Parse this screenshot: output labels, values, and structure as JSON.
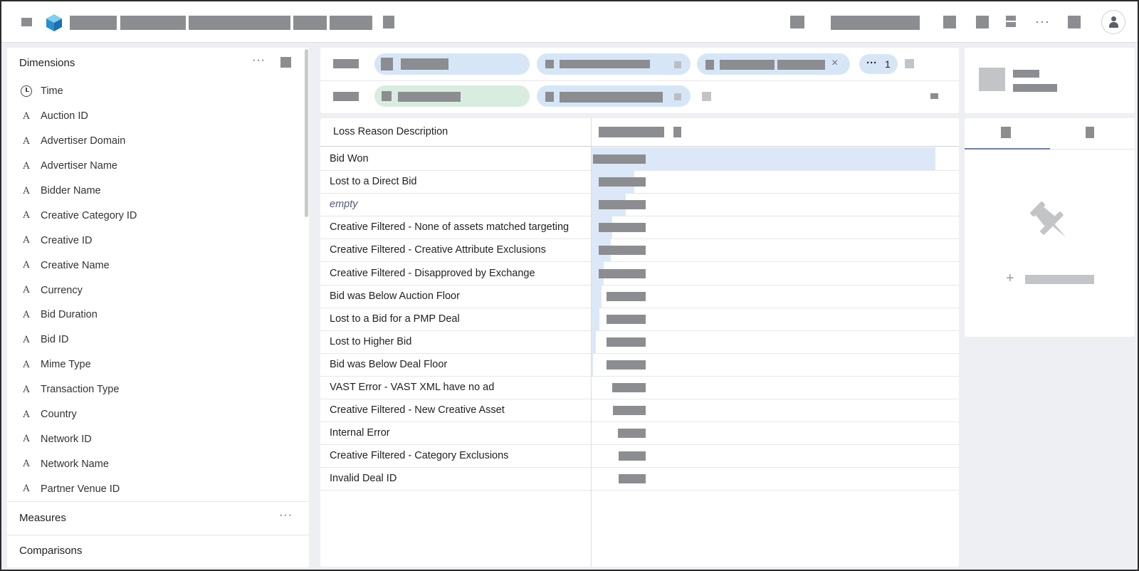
{
  "app": {
    "icons": {
      "menu": "hamburger-icon",
      "logo": "cube-logo-icon",
      "user": "user-icon"
    }
  },
  "sidebar": {
    "dimensions_title": "Dimensions",
    "dimensions_menu": "···",
    "dimensions": [
      {
        "label": "Time",
        "icon": "clock-icon"
      },
      {
        "label": "Auction ID",
        "icon": "text-type-icon"
      },
      {
        "label": "Advertiser Domain",
        "icon": "text-type-icon"
      },
      {
        "label": "Advertiser Name",
        "icon": "text-type-icon"
      },
      {
        "label": "Bidder Name",
        "icon": "text-type-icon"
      },
      {
        "label": "Creative Category ID",
        "icon": "text-type-icon"
      },
      {
        "label": "Creative ID",
        "icon": "text-type-icon"
      },
      {
        "label": "Creative Name",
        "icon": "text-type-icon"
      },
      {
        "label": "Currency",
        "icon": "text-type-icon"
      },
      {
        "label": "Bid Duration",
        "icon": "text-type-icon"
      },
      {
        "label": "Bid ID",
        "icon": "text-type-icon"
      },
      {
        "label": "Mime Type",
        "icon": "text-type-icon"
      },
      {
        "label": "Transaction Type",
        "icon": "text-type-icon"
      },
      {
        "label": "Country",
        "icon": "text-type-icon"
      },
      {
        "label": "Network ID",
        "icon": "text-type-icon"
      },
      {
        "label": "Network Name",
        "icon": "text-type-icon"
      },
      {
        "label": "Partner Venue ID",
        "icon": "text-type-icon"
      }
    ],
    "type_glyph": "A",
    "measures_title": "Measures",
    "measures_menu": "···",
    "comparisons_title": "Comparisons"
  },
  "filters": {
    "overflow_dots": "···",
    "overflow_count": "1",
    "remove_glyph": "×"
  },
  "table": {
    "header": "Loss Reason Description",
    "rows": [
      {
        "name": "Bid Won",
        "share": 1.0,
        "empty": false
      },
      {
        "name": "Lost to a Direct Bid",
        "share": 0.125,
        "empty": false
      },
      {
        "name": "empty",
        "share": 0.1,
        "empty": true
      },
      {
        "name": "Creative Filtered - None of assets matched targeting",
        "share": 0.06,
        "empty": false
      },
      {
        "name": "Creative Filtered - Creative Attribute Exclusions",
        "share": 0.055,
        "empty": false
      },
      {
        "name": "Creative Filtered - Disapproved by Exchange",
        "share": 0.035,
        "empty": false
      },
      {
        "name": "Bid was Below Auction Floor",
        "share": 0.028,
        "empty": false
      },
      {
        "name": "Lost to a Bid for a PMP Deal",
        "share": 0.022,
        "empty": false
      },
      {
        "name": "Lost to Higher Bid",
        "share": 0.012,
        "empty": false
      },
      {
        "name": "Bid was Below Deal Floor",
        "share": 0.004,
        "empty": false
      },
      {
        "name": "VAST Error - VAST XML have no ad",
        "share": 0,
        "empty": false
      },
      {
        "name": "Creative Filtered - New Creative Asset",
        "share": 0,
        "empty": false
      },
      {
        "name": "Internal Error",
        "share": 0,
        "empty": false
      },
      {
        "name": "Creative Filtered - Category Exclusions",
        "share": 0,
        "empty": false
      },
      {
        "name": "Invalid Deal ID",
        "share": 0,
        "empty": false
      }
    ]
  },
  "right_panel": {
    "add_glyph": "+",
    "pin_icon": "pushpin-icon"
  },
  "colors": {
    "bar": "#dce8f8",
    "pill_blue": "#d6e6f7",
    "pill_green": "#d8ede0",
    "accent": "#4a5fa6"
  }
}
